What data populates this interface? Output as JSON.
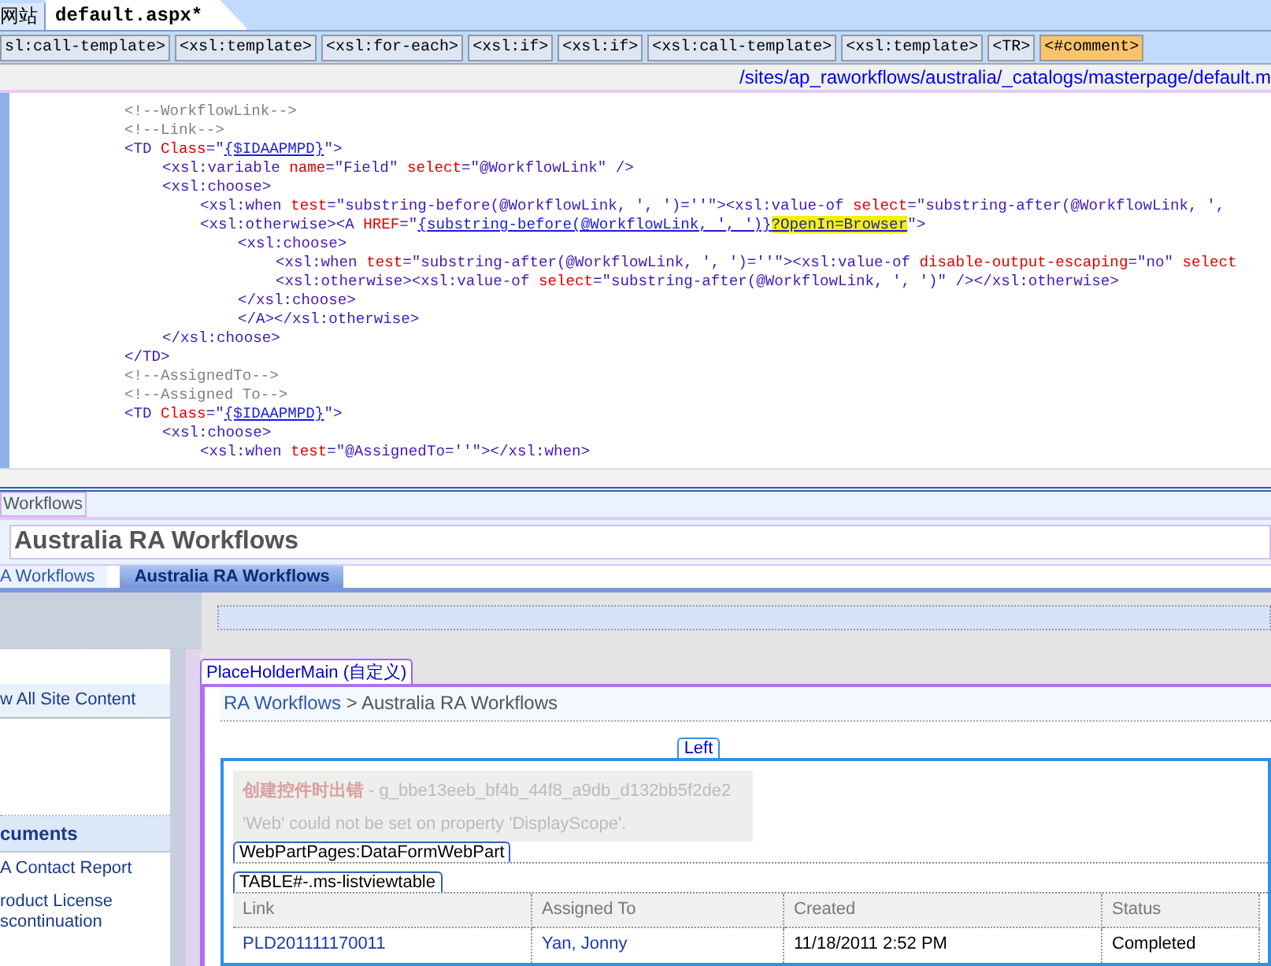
{
  "doc_tabs": [
    {
      "label": "网站",
      "selected": false
    },
    {
      "label": "default.aspx*",
      "selected": true
    }
  ],
  "tag_path": [
    {
      "label": "sl:call-template>",
      "selected": false
    },
    {
      "label": "<xsl:template>",
      "selected": false
    },
    {
      "label": "<xsl:for-each>",
      "selected": false
    },
    {
      "label": "<xsl:if>",
      "selected": false
    },
    {
      "label": "<xsl:if>",
      "selected": false
    },
    {
      "label": "<xsl:call-template>",
      "selected": false
    },
    {
      "label": "<xsl:template>",
      "selected": false
    },
    {
      "label": "<TR>",
      "selected": false
    },
    {
      "label": "<#comment>",
      "selected": true
    }
  ],
  "file_path": "/sites/ap_raworkflows/australia/_catalogs/masterpage/default.m",
  "code_lines": [
    {
      "tokens": [
        {
          "kind": "comment",
          "text": "<!--WorkflowLink-->"
        }
      ]
    },
    {
      "tokens": [
        {
          "kind": "comment",
          "text": "<!--Link-->"
        }
      ]
    },
    {
      "tokens": [
        {
          "kind": "tag",
          "text": "<TD "
        },
        {
          "kind": "attr",
          "text": "Class"
        },
        {
          "kind": "tag",
          "text": "=\""
        },
        {
          "kind": "link",
          "text": "{$IDAAPMPD}"
        },
        {
          "kind": "tag",
          "text": "\">"
        }
      ],
      "children": [
        {
          "tokens": [
            {
              "kind": "tag",
              "text": "<xsl:variable "
            },
            {
              "kind": "attr",
              "text": "name"
            },
            {
              "kind": "tag",
              "text": "=\"Field\" "
            },
            {
              "kind": "attr",
              "text": "select"
            },
            {
              "kind": "tag",
              "text": "=\"@WorkflowLink\" />"
            }
          ]
        },
        {
          "tokens": [
            {
              "kind": "tag",
              "text": "<xsl:choose>"
            }
          ],
          "children": [
            {
              "tokens": [
                {
                  "kind": "tag",
                  "text": "<xsl:when "
                },
                {
                  "kind": "attr",
                  "text": "test"
                },
                {
                  "kind": "tag",
                  "text": "=\"substring-before(@WorkflowLink, ', ')=''\"><xsl:value-of "
                },
                {
                  "kind": "attr",
                  "text": "select"
                },
                {
                  "kind": "tag",
                  "text": "=\"substring-after(@WorkflowLink, ',"
                }
              ]
            },
            {
              "tokens": [
                {
                  "kind": "tag",
                  "text": "<xsl:otherwise><A "
                },
                {
                  "kind": "attr",
                  "text": "HREF"
                },
                {
                  "kind": "tag",
                  "text": "=\""
                },
                {
                  "kind": "link",
                  "text": "{substring-before(@WorkflowLink, ', ')}"
                },
                {
                  "kind": "highlight",
                  "text": "?OpenIn=Browser"
                },
                {
                  "kind": "tag",
                  "text": "\">"
                }
              ],
              "children": [
                {
                  "tokens": [
                    {
                      "kind": "tag",
                      "text": "<xsl:choose>"
                    }
                  ],
                  "children": [
                    {
                      "tokens": [
                        {
                          "kind": "tag",
                          "text": "<xsl:when "
                        },
                        {
                          "kind": "attr",
                          "text": "test"
                        },
                        {
                          "kind": "tag",
                          "text": "=\"substring-after(@WorkflowLink, ', ')=''\"><xsl:value-of "
                        },
                        {
                          "kind": "attr",
                          "text": "disable-output-escaping"
                        },
                        {
                          "kind": "tag",
                          "text": "=\"no\" "
                        },
                        {
                          "kind": "attr",
                          "text": "select"
                        }
                      ]
                    },
                    {
                      "tokens": [
                        {
                          "kind": "tag",
                          "text": "<xsl:otherwise><xsl:value-of "
                        },
                        {
                          "kind": "attr",
                          "text": "select"
                        },
                        {
                          "kind": "tag",
                          "text": "=\"substring-after(@WorkflowLink, ', ')\" /></xsl:otherwise>"
                        }
                      ]
                    }
                  ]
                },
                {
                  "tokens": [
                    {
                      "kind": "tag",
                      "text": "</xsl:choose>"
                    }
                  ]
                },
                {
                  "tokens": [
                    {
                      "kind": "tag",
                      "text": "</A></xsl:otherwise>"
                    }
                  ]
                }
              ]
            }
          ]
        },
        {
          "tokens": [
            {
              "kind": "tag",
              "text": "</xsl:choose>"
            }
          ]
        }
      ]
    },
    {
      "tokens": [
        {
          "kind": "tag",
          "text": "</TD>"
        }
      ]
    },
    {
      "tokens": [
        {
          "kind": "comment",
          "text": "<!--AssignedTo-->"
        }
      ]
    },
    {
      "tokens": [
        {
          "kind": "comment",
          "text": "<!--Assigned To-->"
        }
      ]
    },
    {
      "tokens": [
        {
          "kind": "tag",
          "text": "<TD "
        },
        {
          "kind": "attr",
          "text": "Class"
        },
        {
          "kind": "tag",
          "text": "=\""
        },
        {
          "kind": "link",
          "text": "{$IDAAPMPD}"
        },
        {
          "kind": "tag",
          "text": "\">"
        }
      ],
      "children": [
        {
          "tokens": [
            {
              "kind": "tag",
              "text": "<xsl:choose>"
            }
          ],
          "children": [
            {
              "tokens": [
                {
                  "kind": "tag",
                  "text": "<xsl:when "
                },
                {
                  "kind": "attr",
                  "text": "test"
                },
                {
                  "kind": "tag",
                  "text": "=\"@AssignedTo=''\"></xsl:when>"
                }
              ]
            }
          ]
        }
      ]
    }
  ],
  "design": {
    "region_label": "Workflows",
    "site_title": "Australia RA Workflows",
    "top_tabs": [
      {
        "label": "A Workflows",
        "selected": false
      },
      {
        "label": "Australia RA Workflows",
        "selected": true
      }
    ],
    "nav": [
      {
        "kind": "link",
        "label": "w All Site Content",
        "selected": true
      },
      {
        "kind": "blank"
      },
      {
        "kind": "header",
        "label": "cuments"
      },
      {
        "kind": "link",
        "label": "A Contact Report",
        "selected": false
      },
      {
        "kind": "link",
        "label": "roduct License\nscontinuation",
        "selected": false
      }
    ],
    "placeholder_tag": "PlaceHolderMain (自定义)",
    "breadcrumb": {
      "link": "RA Workflows",
      "separator": ">",
      "current": "Australia RA Workflows"
    },
    "zone_tag": "Left",
    "error": {
      "title": "创建控件时出错",
      "id": " - g_bbe13eeb_bf4b_44f8_a9db_d132bb5f2de2",
      "message": "'Web' could not be set on property 'DisplayScope'."
    },
    "webpart_tag": "WebPartPages:DataFormWebPart",
    "table_tag": "TABLE#-.ms-listviewtable",
    "table": {
      "columns": [
        "Link",
        "Assigned To",
        "Created",
        "Status"
      ],
      "rows": [
        [
          "PLD201111170011",
          "Yan, Jonny",
          "11/18/2011 2:52 PM",
          "Completed"
        ]
      ]
    }
  }
}
